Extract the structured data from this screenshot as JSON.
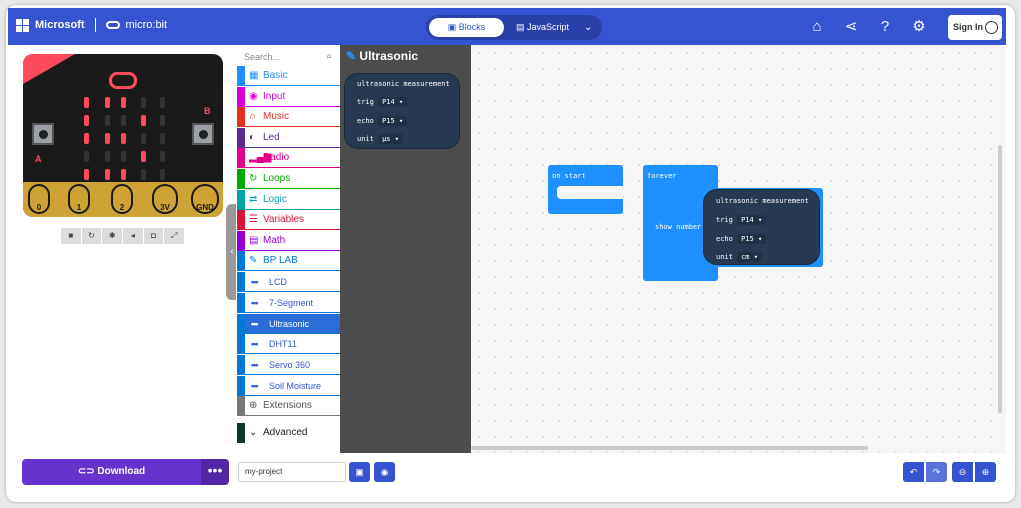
{
  "header": {
    "brand_microsoft": "Microsoft",
    "brand_microbit": "micro:bit",
    "tab_blocks": "Blocks",
    "tab_javascript": "JavaScript",
    "sign_in": "Sign In"
  },
  "simulator": {
    "pins": [
      "0",
      "1",
      "2",
      "3V",
      "GND"
    ],
    "button_a": "A",
    "button_b": "B"
  },
  "toolbox": {
    "search_placeholder": "Search...",
    "categories": [
      {
        "label": "Basic",
        "color": "#1e90ff"
      },
      {
        "label": "Input",
        "color": "#d400d4"
      },
      {
        "label": "Music",
        "color": "#e63022"
      },
      {
        "label": "Led",
        "color": "#5c2d91"
      },
      {
        "label": "Radio",
        "color": "#e3008c"
      },
      {
        "label": "Loops",
        "color": "#00aa00"
      },
      {
        "label": "Logic",
        "color": "#00a4a6"
      },
      {
        "label": "Variables",
        "color": "#dc143c"
      },
      {
        "label": "Math",
        "color": "#9400d3"
      },
      {
        "label": "BP LAB",
        "color": "#0078d7"
      }
    ],
    "subcategories": [
      "LCD",
      "7-Segment",
      "Ultrasonic",
      "DHT11",
      "Servo 360",
      "Soil Moisture"
    ],
    "extensions": "Extensions",
    "advanced": "Advanced"
  },
  "flyout": {
    "title": "Ultrasonic",
    "block_title": "ultrasonic measurement",
    "trig_label": "trig",
    "trig_value": "P14",
    "echo_label": "echo",
    "echo_value": "P15",
    "unit_label": "unit",
    "unit_value": "µs"
  },
  "workspace": {
    "on_start": "on start",
    "forever": "forever",
    "show_number": "show number",
    "block_title": "ultrasonic measurement",
    "trig_label": "trig",
    "trig_value": "P14",
    "echo_label": "echo",
    "echo_value": "P15",
    "unit_label": "unit",
    "unit_value": "cm"
  },
  "footer": {
    "download": "Download",
    "more": "•••",
    "project_name": "my-project"
  }
}
